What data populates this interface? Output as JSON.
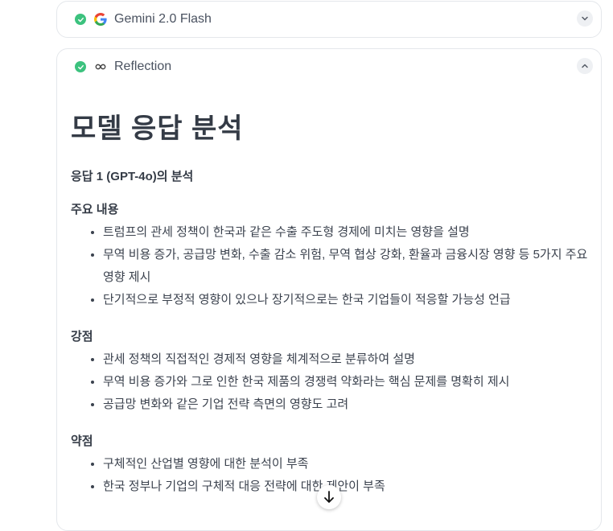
{
  "cards": [
    {
      "model": "Gemini 2.0 Flash",
      "expanded": false
    },
    {
      "model": "Reflection",
      "expanded": true
    }
  ],
  "content": {
    "title": "모델 응답 분석",
    "subheading": "응답 1 (GPT-4o)의 분석",
    "sections": [
      {
        "title": "주요 내용",
        "items": [
          "트럼프의 관세 정책이 한국과 같은 수출 주도형 경제에 미치는 영향을 설명",
          "무역 비용 증가, 공급망 변화, 수출 감소 위험, 무역 협상 강화, 환율과 금융시장 영향 등 5가지 주요 영향 제시",
          "단기적으로 부정적 영향이 있으나 장기적으로는 한국 기업들이 적응할 가능성 언급"
        ]
      },
      {
        "title": "강점",
        "items": [
          "관세 정책의 직접적인 경제적 영향을 체계적으로 분류하여 설명",
          "무역 비용 증가와 그로 인한 한국 제품의 경쟁력 약화라는 핵심 문제를 명확히 제시",
          "공급망 변화와 같은 기업 전략 측면의 영향도 고려"
        ]
      },
      {
        "title": "약점",
        "items": [
          "구체적인 산업별 영향에 대한 분석이 부족",
          "한국 정부나 기업의 구체적 대응 전략에 대한 제안이 부족"
        ]
      }
    ]
  },
  "colors": {
    "check": "#3cc27e",
    "text": "#343b46"
  }
}
